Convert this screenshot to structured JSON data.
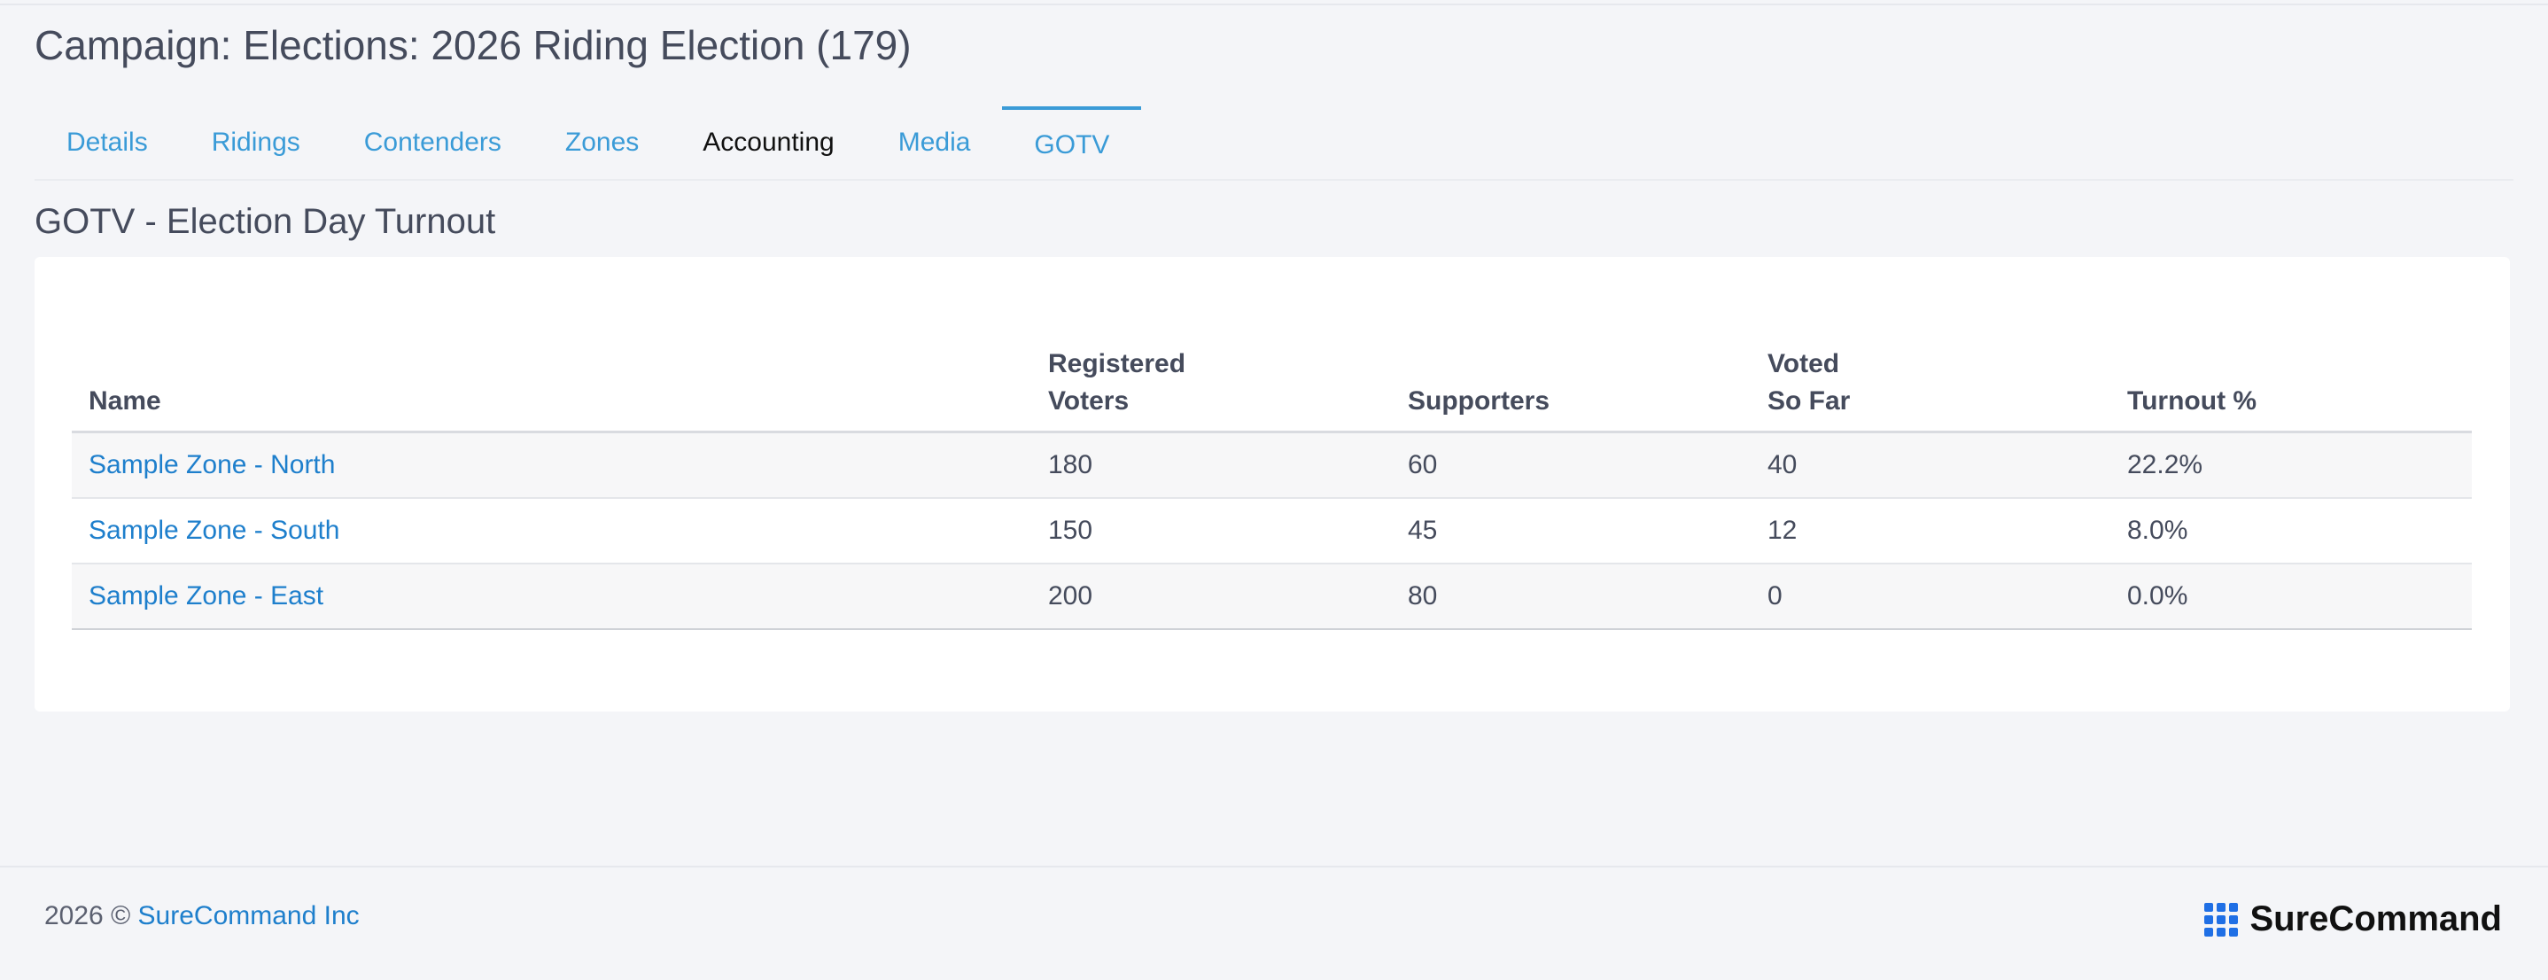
{
  "page": {
    "title": "Campaign: Elections: 2026 Riding Election (179)"
  },
  "tabs": [
    {
      "label": "Details"
    },
    {
      "label": "Ridings"
    },
    {
      "label": "Contenders"
    },
    {
      "label": "Zones"
    },
    {
      "label": "Accounting"
    },
    {
      "label": "Media"
    },
    {
      "label": "GOTV"
    }
  ],
  "active_tab": "GOTV",
  "section": {
    "title": "GOTV - Election Day Turnout"
  },
  "table": {
    "headers": {
      "name": "Name",
      "registered_line1": "Registered",
      "registered_line2": "Voters",
      "supporters": "Supporters",
      "voted_line1": "Voted",
      "voted_line2": "So Far",
      "turnout": "Turnout %"
    },
    "rows": [
      {
        "name": "Sample Zone - North",
        "registered": "180",
        "supporters": "60",
        "voted": "40",
        "turnout": "22.2%"
      },
      {
        "name": "Sample Zone - South",
        "registered": "150",
        "supporters": "45",
        "voted": "12",
        "turnout": "8.0%"
      },
      {
        "name": "Sample Zone - East",
        "registered": "200",
        "supporters": "80",
        "voted": "0",
        "turnout": "0.0%"
      }
    ]
  },
  "footer": {
    "copyright_prefix": "2026 ©",
    "company_link": "SureCommand Inc",
    "brand_name": "SureCommand"
  },
  "icons": {
    "brand_logo": "grid-logo-icon"
  },
  "colors": {
    "link": "#1e7fcc",
    "tab_link": "#3a9bd7",
    "brand_blue": "#1f6fe5"
  }
}
